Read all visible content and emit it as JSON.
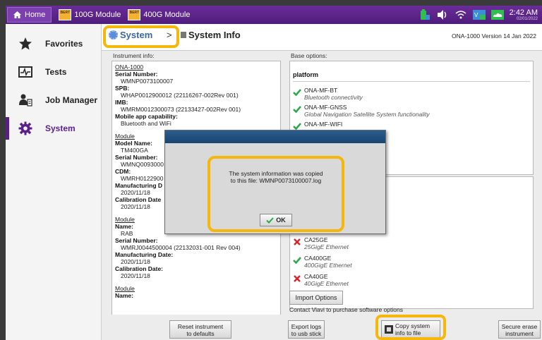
{
  "topbar": {
    "home_label": "Home",
    "module1_label": "100G Module",
    "module2_label": "400G Module",
    "module_icon_text": "BERT",
    "time": "2:42 AM",
    "date": "02/01/2022"
  },
  "sidebar": {
    "items": [
      {
        "label": "Favorites",
        "icon": "star-icon"
      },
      {
        "label": "Tests",
        "icon": "tests-icon"
      },
      {
        "label": "Job Manager",
        "icon": "job-manager-icon"
      },
      {
        "label": "System",
        "icon": "gear-icon"
      }
    ]
  },
  "header": {
    "breadcrumb_root": "System",
    "separator": ">",
    "breadcrumb_current": "System Info",
    "version": "ONA-1000 Version 14 Jan 2022"
  },
  "instrument": {
    "label": "Instrument info:",
    "lines": [
      {
        "t": "u",
        "s": "ONA-1000"
      },
      {
        "t": "b",
        "s": "Serial Number:"
      },
      {
        "t": "v",
        "s": "WMNP0073100007"
      },
      {
        "t": "b",
        "s": "SPB:"
      },
      {
        "t": "v",
        "s": "WHAP0012900012 (22116267-002Rev 001)"
      },
      {
        "t": "b",
        "s": "IMB:"
      },
      {
        "t": "v",
        "s": "WMRM0012300073 (22133427-002Rev 001)"
      },
      {
        "t": "b",
        "s": "Mobile app capability:"
      },
      {
        "t": "v",
        "s": "Bluetooth and WiFi"
      },
      {
        "t": "gap",
        "s": ""
      },
      {
        "t": "u",
        "s": "Module"
      },
      {
        "t": "b",
        "s": "Model Name:"
      },
      {
        "t": "v",
        "s": "TM400GA"
      },
      {
        "t": "b",
        "s": "Serial Number:"
      },
      {
        "t": "v",
        "s": "WMNQ0093000"
      },
      {
        "t": "b",
        "s": "CDM:"
      },
      {
        "t": "v",
        "s": "WMRH0122900"
      },
      {
        "t": "b",
        "s": "Manufacturing D"
      },
      {
        "t": "v",
        "s": "2020/11/18"
      },
      {
        "t": "b",
        "s": "Calibration Date"
      },
      {
        "t": "v",
        "s": "2020/11/18"
      },
      {
        "t": "gap",
        "s": ""
      },
      {
        "t": "u",
        "s": "Module"
      },
      {
        "t": "b",
        "s": "Name:"
      },
      {
        "t": "v",
        "s": "RAB"
      },
      {
        "t": "b",
        "s": "Serial Number:"
      },
      {
        "t": "v",
        "s": "WMRJ0044500004 (22132031-001 Rev 004)"
      },
      {
        "t": "b",
        "s": "Manufacturing Date:"
      },
      {
        "t": "v",
        "s": "2020/11/18"
      },
      {
        "t": "b",
        "s": "Calibration Date:"
      },
      {
        "t": "v",
        "s": "2020/11/18"
      },
      {
        "t": "gap",
        "s": ""
      },
      {
        "t": "u",
        "s": "Module"
      },
      {
        "t": "b",
        "s": "Name:"
      }
    ]
  },
  "base": {
    "label": "Base options:",
    "header": "platform",
    "options": [
      {
        "name": "ONA-MF-BT",
        "desc": "Bluetooth connectivity",
        "ok": true
      },
      {
        "name": "ONA-MF-GNSS",
        "desc": "Global Navigation Satellite System functionality",
        "ok": true
      },
      {
        "name": "ONA-MF-WIFI",
        "desc": "",
        "ok": true
      }
    ]
  },
  "licenses": {
    "options": [
      {
        "name": "CA25GE",
        "desc": "25GigE Ethernet",
        "ok": false
      },
      {
        "name": "CA400GE",
        "desc": "400GigE Ethernet",
        "ok": true
      },
      {
        "name": "CA40GE",
        "desc": "40GigE Ethernet",
        "ok": false
      }
    ],
    "import_label": "Import Options",
    "contact": "Contact Viavi to purchase software options"
  },
  "bottom": {
    "reset_line1": "Reset instrument",
    "reset_line2": "to defaults",
    "export_line1": "Export logs",
    "export_line2": "to usb stick",
    "copy_line1": "Copy system",
    "copy_line2": "info to file",
    "erase_line1": "Secure erase",
    "erase_line2": "instrument"
  },
  "dialog": {
    "line1": "The system information was copied",
    "line2": "to this file: WMNP0073100007.log",
    "ok_label": "OK"
  },
  "colors": {
    "topbar": "#5a228a",
    "highlight": "#f5b70c",
    "check": "#2aa84a",
    "cross": "#d8262a"
  }
}
